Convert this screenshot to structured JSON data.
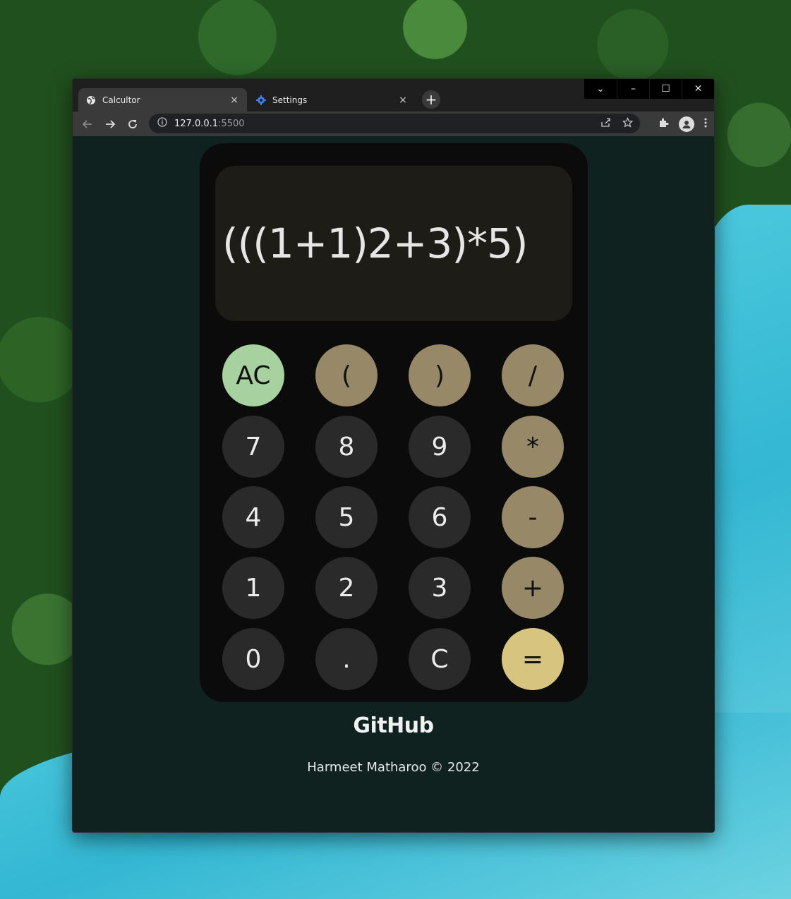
{
  "browser": {
    "tabs": [
      {
        "label": "Calcultor",
        "icon": "globe-icon"
      },
      {
        "label": "Settings",
        "icon": "gear-icon"
      }
    ],
    "tab_close": "×",
    "new_tab": "+",
    "url_host": "127.0.0.1",
    "url_port": ":5500",
    "window_controls": {
      "dropdown": "⌄",
      "minimize": "–",
      "maximize": "☐",
      "close": "✕"
    }
  },
  "calculator": {
    "display": "(((1+1)2+3)*5)",
    "keys": [
      {
        "label": "AC",
        "kind": "clear"
      },
      {
        "label": "(",
        "kind": "op"
      },
      {
        "label": ")",
        "kind": "op"
      },
      {
        "label": "/",
        "kind": "op"
      },
      {
        "label": "7",
        "kind": "num"
      },
      {
        "label": "8",
        "kind": "num"
      },
      {
        "label": "9",
        "kind": "num"
      },
      {
        "label": "*",
        "kind": "op"
      },
      {
        "label": "4",
        "kind": "num"
      },
      {
        "label": "5",
        "kind": "num"
      },
      {
        "label": "6",
        "kind": "num"
      },
      {
        "label": "-",
        "kind": "op"
      },
      {
        "label": "1",
        "kind": "num"
      },
      {
        "label": "2",
        "kind": "num"
      },
      {
        "label": "3",
        "kind": "num"
      },
      {
        "label": "+",
        "kind": "op"
      },
      {
        "label": "0",
        "kind": "num"
      },
      {
        "label": ".",
        "kind": "num"
      },
      {
        "label": "C",
        "kind": "num"
      },
      {
        "label": "=",
        "kind": "eq"
      }
    ]
  },
  "footer": {
    "github": "GitHub",
    "credit": "Harmeet Matharoo © 2022"
  },
  "colors": {
    "page_bg": "#0f221f",
    "calc_bg": "#0b0b0b",
    "display_bg": "#1e1c16",
    "num_key": "#2a2a2a",
    "op_key": "#978968",
    "clear_key": "#a8d1a0",
    "equals_key": "#d6c47f"
  }
}
